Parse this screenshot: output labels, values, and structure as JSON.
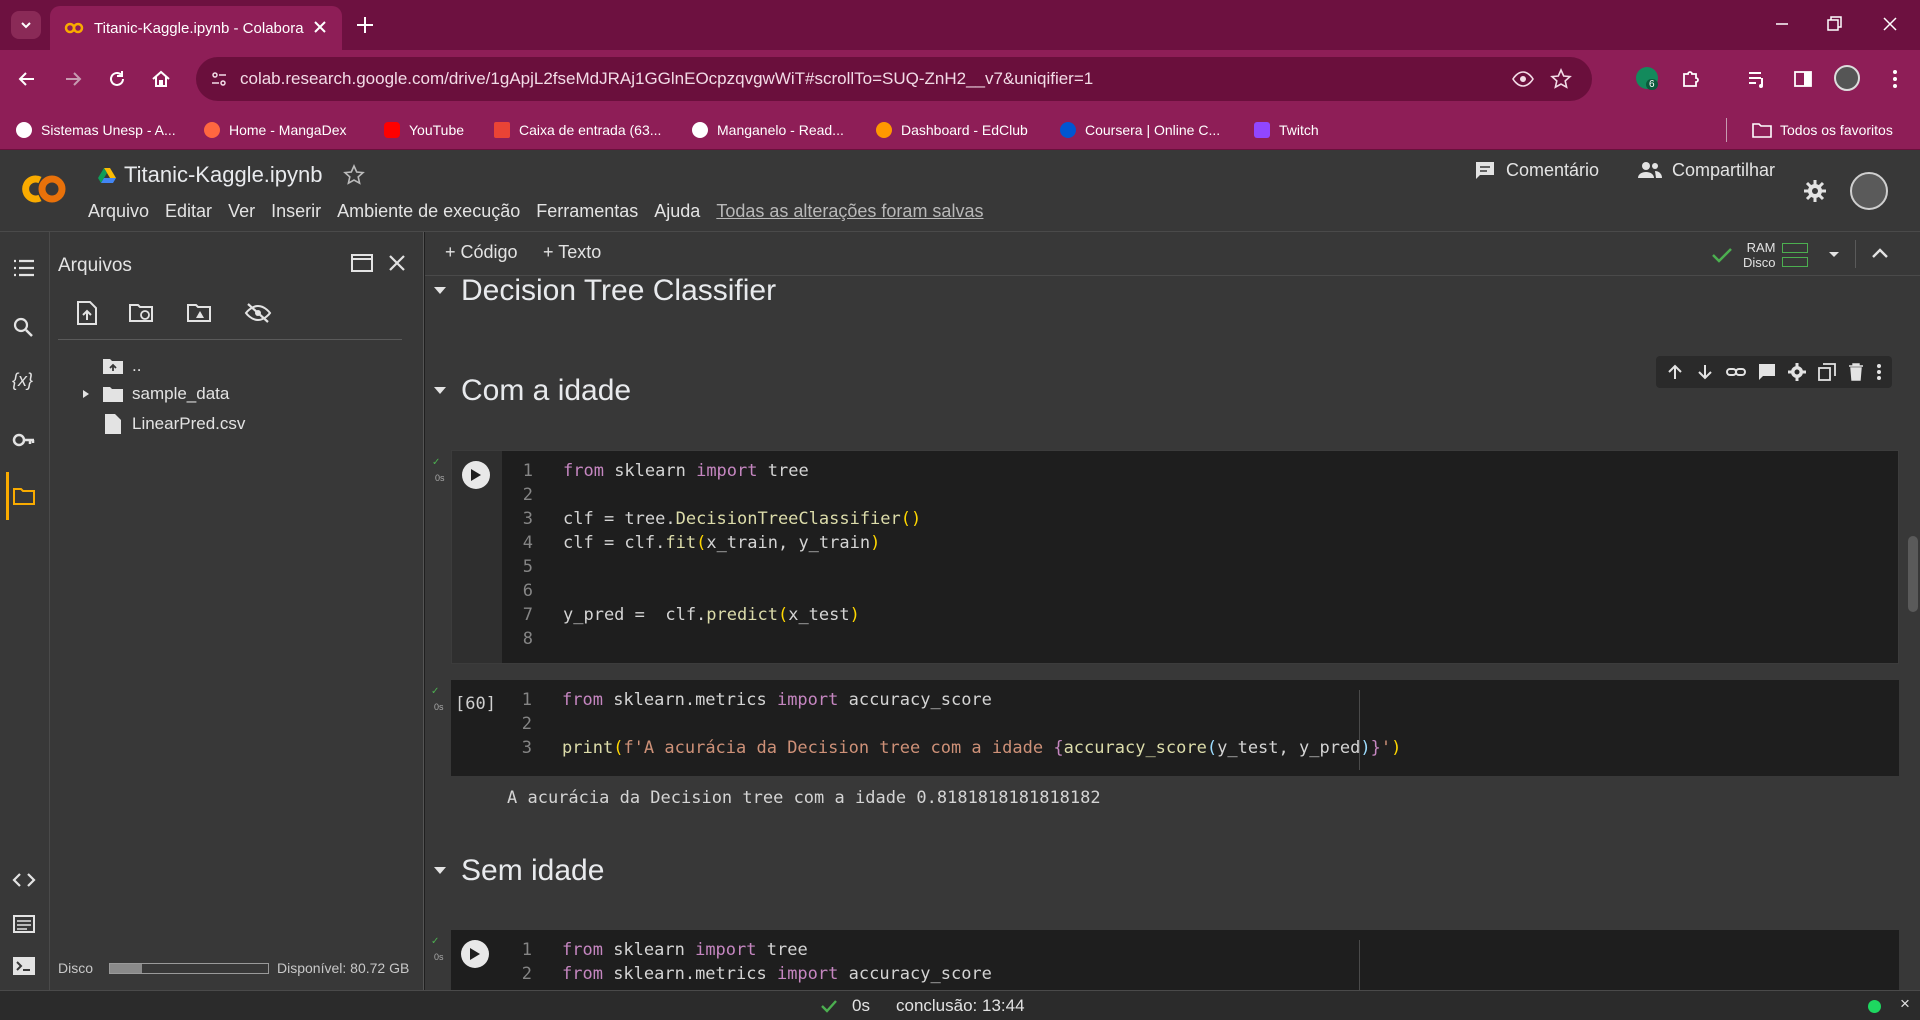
{
  "browser": {
    "tab_title": "Titanic-Kaggle.ipynb - Colabora",
    "url": "colab.research.google.com/drive/1gApjL2fseMdJRAj1GGlnEOcpzqvgwWiT#scrollTo=SUQ-ZnH2__v7&uniqifier=1",
    "extension_badge": "6",
    "bookmarks": [
      {
        "label": "Sistemas Unesp - A...",
        "color": "#ffffff"
      },
      {
        "label": "Home - MangaDex",
        "color": "#ff6740"
      },
      {
        "label": "YouTube",
        "color": "#ff0000"
      },
      {
        "label": "Caixa de entrada (63...",
        "color": "#ea4335"
      },
      {
        "label": "Manganelo - Read...",
        "color": "#ffffff"
      },
      {
        "label": "Dashboard - EdClub",
        "color": "#ff9800"
      },
      {
        "label": "Coursera | Online C...",
        "color": "#0056d2"
      },
      {
        "label": "Twitch",
        "color": "#9146ff"
      }
    ],
    "all_bookmarks": "Todos os favoritos"
  },
  "header": {
    "notebook_name": "Titanic-Kaggle.ipynb",
    "menus": [
      "Arquivo",
      "Editar",
      "Ver",
      "Inserir",
      "Ambiente de execução",
      "Ferramentas",
      "Ajuda"
    ],
    "saved_status": "Todas as alterações foram salvas",
    "comment": "Comentário",
    "share": "Compartilhar"
  },
  "files": {
    "title": "Arquivos",
    "items": [
      "..",
      "sample_data",
      "LinearPred.csv"
    ],
    "disk_label": "Disco",
    "disk_available": "Disponível: 80.72 GB",
    "disk_used_fraction": 0.2
  },
  "toolbar": {
    "code": "+ Código",
    "text": "+ Texto",
    "ram": "RAM",
    "disk": "Disco"
  },
  "sections": [
    "Decision Tree Classifier",
    "Com a idade",
    "Sem idade"
  ],
  "cells": [
    {
      "exec": "",
      "status": "0s",
      "lines": [
        [
          {
            "c": "kw",
            "t": "from "
          },
          {
            "c": "pl",
            "t": "sklearn "
          },
          {
            "c": "kw",
            "t": "import "
          },
          {
            "c": "pl",
            "t": "tree"
          }
        ],
        [],
        [
          {
            "c": "pl",
            "t": "clf = tree."
          },
          {
            "c": "fn",
            "t": "DecisionTreeClassifier"
          },
          {
            "c": "br",
            "t": "()"
          }
        ],
        [
          {
            "c": "pl",
            "t": "clf = clf."
          },
          {
            "c": "fn",
            "t": "fit"
          },
          {
            "c": "br",
            "t": "("
          },
          {
            "c": "pl",
            "t": "x_train, y_train"
          },
          {
            "c": "br",
            "t": ")"
          }
        ],
        [],
        [],
        [
          {
            "c": "pl",
            "t": "y_pred =  clf."
          },
          {
            "c": "fn",
            "t": "predict"
          },
          {
            "c": "br",
            "t": "("
          },
          {
            "c": "pl",
            "t": "x_test"
          },
          {
            "c": "br",
            "t": ")"
          }
        ],
        []
      ]
    },
    {
      "exec": "[60]",
      "status": "0s",
      "lines": [
        [
          {
            "c": "kw",
            "t": "from "
          },
          {
            "c": "pl",
            "t": "sklearn.metrics "
          },
          {
            "c": "kw",
            "t": "import "
          },
          {
            "c": "pl",
            "t": "accuracy_score"
          }
        ],
        [],
        [
          {
            "c": "fn",
            "t": "print"
          },
          {
            "c": "br",
            "t": "("
          },
          {
            "c": "st",
            "t": "f'A acurácia da Decision tree com a idade "
          },
          {
            "c": "kw",
            "t": "{"
          },
          {
            "c": "fn",
            "t": "accuracy_score"
          },
          {
            "c": "vr",
            "t": "("
          },
          {
            "c": "pl",
            "t": "y_test, y_pred"
          },
          {
            "c": "vr",
            "t": ")"
          },
          {
            "c": "kw",
            "t": "}"
          },
          {
            "c": "st",
            "t": "'"
          },
          {
            "c": "br",
            "t": ")"
          }
        ]
      ],
      "output": "A acurácia da Decision tree com a idade 0.8181818181818182"
    },
    {
      "exec": "",
      "status": "0s",
      "lines": [
        [
          {
            "c": "kw",
            "t": "from "
          },
          {
            "c": "pl",
            "t": "sklearn "
          },
          {
            "c": "kw",
            "t": "import "
          },
          {
            "c": "pl",
            "t": "tree"
          }
        ],
        [
          {
            "c": "kw",
            "t": "from "
          },
          {
            "c": "pl",
            "t": "sklearn.metrics "
          },
          {
            "c": "kw",
            "t": "import "
          },
          {
            "c": "pl",
            "t": "accuracy_score"
          }
        ]
      ]
    }
  ],
  "statusbar": {
    "time": "0s",
    "completion": "conclusão: 13:44"
  },
  "colors": {
    "accent": "#8e1e57",
    "colab_orange": "#f9ab00",
    "ok_green": "#4caf50"
  }
}
